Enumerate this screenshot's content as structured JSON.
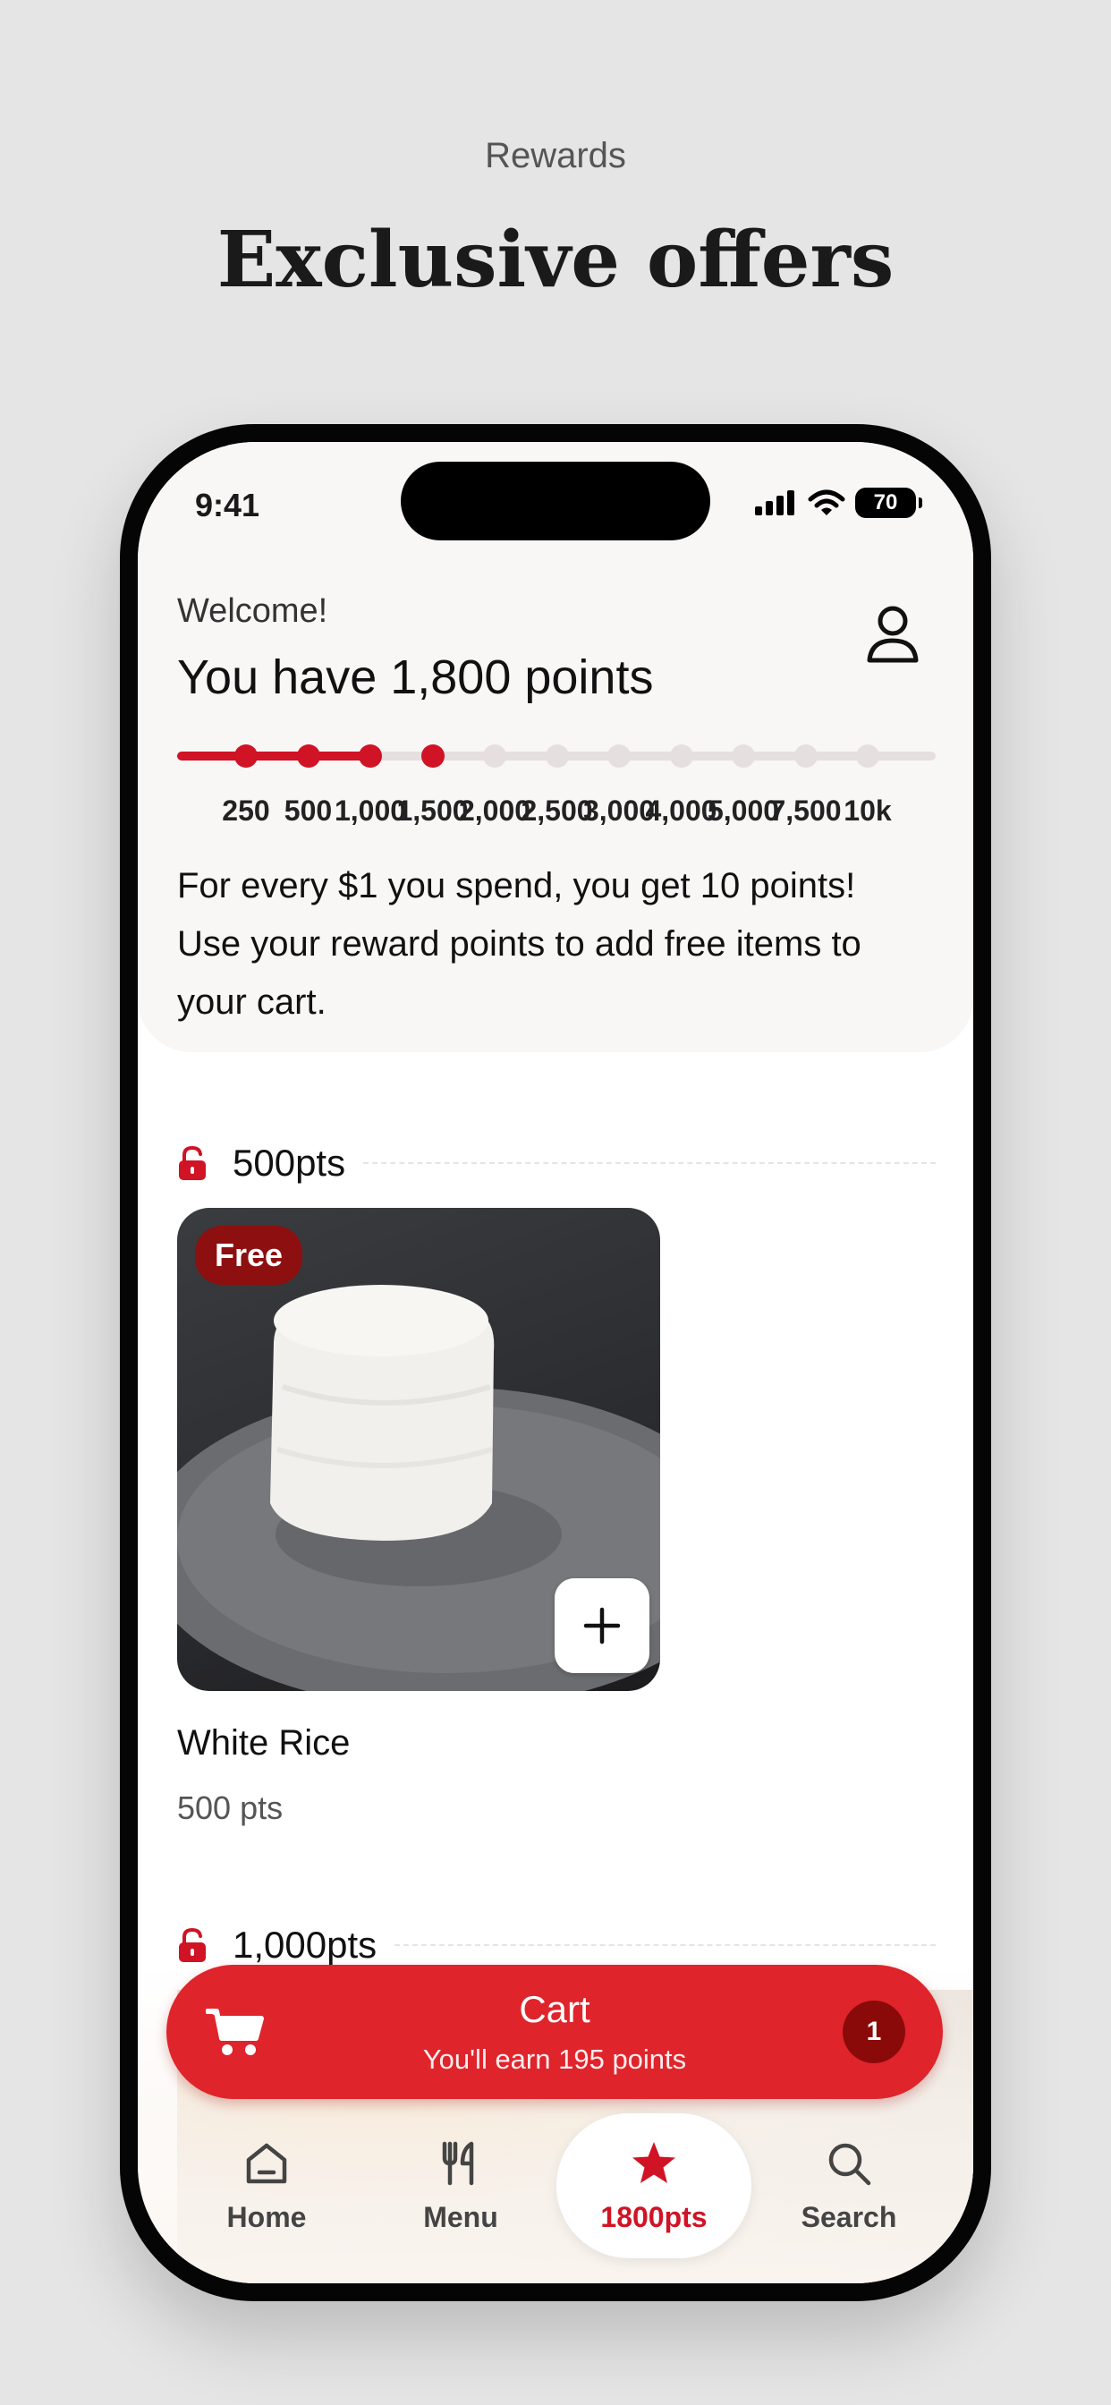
{
  "promo": {
    "eyebrow": "Rewards",
    "title": "Exclusive offers"
  },
  "status_bar": {
    "time": "9:41",
    "battery": "70"
  },
  "header": {
    "welcome": "Welcome!",
    "points_title": "You have 1,800 points",
    "points_balance": 1800,
    "milestones": [
      "250",
      "500",
      "1,000",
      "1,500",
      "2,000",
      "2,500",
      "3,000",
      "4,000",
      "5,000",
      "7,500",
      "10k"
    ],
    "milestones_reached": 4,
    "info_text": "For every $1 you spend, you get 10 points! Use your reward points to add free items to your cart."
  },
  "sections": [
    {
      "tier_label": "500pts",
      "items": [
        {
          "badge": "Free",
          "name": "White Rice",
          "points": "500 pts"
        }
      ]
    },
    {
      "tier_label": "1,000pts"
    }
  ],
  "cart": {
    "title": "Cart",
    "subtitle": "You'll earn 195 points",
    "count": "1"
  },
  "tabbar": {
    "tabs": [
      {
        "label": "Home",
        "icon": "home-icon"
      },
      {
        "label": "Menu",
        "icon": "menu-utensils-icon"
      },
      {
        "label": "1800pts",
        "icon": "star-icon",
        "active": true
      },
      {
        "label": "Search",
        "icon": "search-icon"
      }
    ]
  },
  "colors": {
    "brand_red": "#d01325",
    "cart_red": "#e0242b",
    "badge_dark_red": "#8d0f0f",
    "page_bg": "#e5e5e5"
  }
}
